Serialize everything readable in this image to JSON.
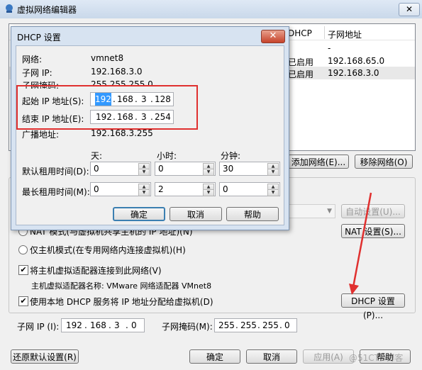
{
  "main": {
    "title": "虚拟网络编辑器",
    "close_glyph": "✕",
    "table": {
      "headers": [
        "DHCP",
        "子网地址"
      ],
      "rows": [
        {
          "dhcp": "",
          "subnet": "-"
        },
        {
          "dhcp": "已启用",
          "subnet": "192.168.65.0"
        },
        {
          "dhcp": "已启用",
          "subnet": "192.168.3.0"
        }
      ]
    },
    "add_network": "添加网络(E)...",
    "remove_network": "移除网络(O)",
    "auto_settings": "自动设置(U)...",
    "nat_mode": "NAT 模式(与虚拟机共享主机的 IP 地址)(N)",
    "nat_settings": "NAT 设置(S)...",
    "hostonly_mode": "仅主机模式(在专用网络内连接虚拟机)(H)",
    "connect_adapter": "将主机虚拟适配器连接到此网络(V)",
    "adapter_name": "主机虚拟适配器名称: VMware 网络适配器 VMnet8",
    "use_dhcp": "使用本地 DHCP 服务将 IP 地址分配给虚拟机(D)",
    "dhcp_settings": "DHCP 设置(P)...",
    "subnet_ip_label": "子网 IP (I):",
    "subnet_ip": [
      "192",
      "168",
      "3",
      "0"
    ],
    "subnet_mask_label": "子网掩码(M):",
    "subnet_mask": [
      "255",
      "255",
      "255",
      "0"
    ],
    "restore_defaults": "还原默认设置(R)",
    "ok": "确定",
    "cancel": "取消",
    "apply": "应用(A)",
    "help": "帮助",
    "watermark": "@51CTO博客"
  },
  "dialog": {
    "title": "DHCP 设置",
    "close_glyph": "✕",
    "network_label": "网络:",
    "network_value": "vmnet8",
    "subnet_ip_label": "子网 IP:",
    "subnet_ip_value": "192.168.3.0",
    "subnet_mask_label": "子网掩码:",
    "subnet_mask_value": "255.255.255.0",
    "start_ip_label": "起始 IP 地址(S):",
    "start_ip": [
      "192",
      "168",
      "3",
      "128"
    ],
    "end_ip_label": "结束 IP 地址(E):",
    "end_ip": [
      "192",
      "168",
      "3",
      "254"
    ],
    "broadcast_label": "广播地址:",
    "broadcast_value": "192.168.3.255",
    "col_days": "天:",
    "col_hours": "小时:",
    "col_minutes": "分钟:",
    "default_lease_label": "默认租用时间(D):",
    "default_lease": [
      "0",
      "0",
      "30"
    ],
    "max_lease_label": "最长租用时间(M):",
    "max_lease": [
      "0",
      "2",
      "0"
    ],
    "ok": "确定",
    "cancel": "取消",
    "help": "帮助"
  },
  "colors": {
    "highlight_box": "#e0302f",
    "arrow": "#e0302f",
    "selection": "#3399ff"
  }
}
